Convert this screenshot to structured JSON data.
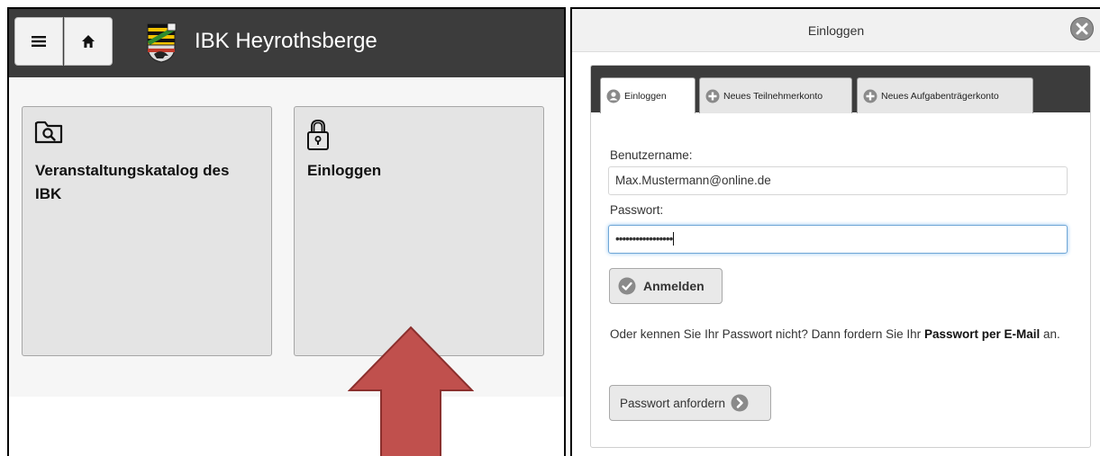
{
  "app": {
    "title": "IBK Heyrothsberge",
    "tiles": [
      {
        "label": "Veranstaltungskatalog des IBK",
        "icon": "folder-search-icon"
      },
      {
        "label": "Einloggen",
        "icon": "padlock-icon"
      }
    ],
    "menu_icon": "hamburger-menu-icon",
    "home_icon": "home-icon",
    "arrow_color": "#c0504d"
  },
  "dialog": {
    "title": "Einloggen",
    "tabs": [
      {
        "label": "Einloggen",
        "active": true,
        "icon": "user-icon"
      },
      {
        "label": "Neues Teilnehmerkonto",
        "active": false,
        "icon": "plus-circle-icon"
      },
      {
        "label": "Neues Aufgabenträgerkonto",
        "active": false,
        "icon": "plus-circle-icon"
      }
    ],
    "username_label": "Benutzername:",
    "username_value": "Max.Mustermann@online.de",
    "password_label": "Passwort:",
    "password_value": "•••••••••••••••••",
    "login_button": "Anmelden",
    "forgot_text_before": "Oder kennen Sie Ihr Passwort nicht? Dann fordern Sie Ihr ",
    "forgot_text_bold": "Passwort per E-Mail",
    "forgot_text_after": " an.",
    "request_button": "Passwort anfordern"
  }
}
